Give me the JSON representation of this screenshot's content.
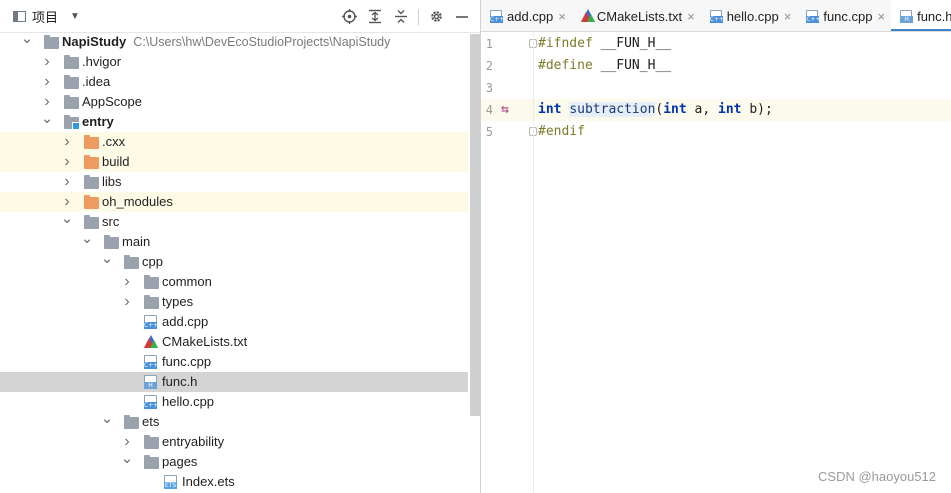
{
  "project_panel": {
    "title": "项目",
    "tools": [
      "crosshair-icon",
      "expand-all-icon",
      "collapse-all-icon",
      "gear-icon",
      "hide-icon"
    ]
  },
  "tree": [
    {
      "name": "NapiStudy",
      "path": "C:\\Users\\hw\\DevEcoStudioProjects\\NapiStudy",
      "depth": 0,
      "type": "folder",
      "expanded": true,
      "bold": true
    },
    {
      "name": ".hvigor",
      "depth": 1,
      "type": "folder",
      "expanded": false
    },
    {
      "name": ".idea",
      "depth": 1,
      "type": "folder",
      "expanded": false
    },
    {
      "name": "AppScope",
      "depth": 1,
      "type": "folder",
      "expanded": false
    },
    {
      "name": "entry",
      "depth": 1,
      "type": "module",
      "expanded": true,
      "bold": true
    },
    {
      "name": ".cxx",
      "depth": 2,
      "type": "folder-orange",
      "expanded": false,
      "excluded": true
    },
    {
      "name": "build",
      "depth": 2,
      "type": "folder-orange",
      "expanded": false,
      "excluded": true
    },
    {
      "name": "libs",
      "depth": 2,
      "type": "folder",
      "expanded": false
    },
    {
      "name": "oh_modules",
      "depth": 2,
      "type": "folder-orange",
      "expanded": false,
      "excluded": true
    },
    {
      "name": "src",
      "depth": 2,
      "type": "folder",
      "expanded": true
    },
    {
      "name": "main",
      "depth": 3,
      "type": "folder",
      "expanded": true
    },
    {
      "name": "cpp",
      "depth": 4,
      "type": "folder",
      "expanded": true
    },
    {
      "name": "common",
      "depth": 5,
      "type": "folder",
      "expanded": false
    },
    {
      "name": "types",
      "depth": 5,
      "type": "folder",
      "expanded": false
    },
    {
      "name": "add.cpp",
      "depth": 5,
      "type": "cpp"
    },
    {
      "name": "CMakeLists.txt",
      "depth": 5,
      "type": "cmake"
    },
    {
      "name": "func.cpp",
      "depth": 5,
      "type": "cpp"
    },
    {
      "name": "func.h",
      "depth": 5,
      "type": "h",
      "selected": true
    },
    {
      "name": "hello.cpp",
      "depth": 5,
      "type": "cpp"
    },
    {
      "name": "ets",
      "depth": 4,
      "type": "folder",
      "expanded": true
    },
    {
      "name": "entryability",
      "depth": 5,
      "type": "folder",
      "expanded": false
    },
    {
      "name": "pages",
      "depth": 5,
      "type": "folder",
      "expanded": true
    },
    {
      "name": "Index.ets",
      "depth": 6,
      "type": "ets"
    }
  ],
  "tabs": [
    {
      "label": "add.cpp",
      "type": "cpp",
      "closable": true
    },
    {
      "label": "CMakeLists.txt",
      "type": "cmake",
      "closable": true
    },
    {
      "label": "hello.cpp",
      "type": "cpp",
      "closable": true
    },
    {
      "label": "func.cpp",
      "type": "cpp",
      "closable": true
    },
    {
      "label": "func.h",
      "type": "h",
      "closable": true,
      "active": true
    }
  ],
  "file_type_tags": {
    "cpp": "C++",
    "h": "H",
    "ets": "ETS"
  },
  "editor": {
    "lines": [
      {
        "num": "1",
        "tokens": [
          {
            "t": "#ifndef ",
            "c": "pp"
          },
          {
            "t": "__FUN_H__"
          }
        ]
      },
      {
        "num": "2",
        "tokens": [
          {
            "t": "#define ",
            "c": "pp"
          },
          {
            "t": "__FUN_H__"
          }
        ]
      },
      {
        "num": "3",
        "tokens": []
      },
      {
        "num": "4",
        "current": true,
        "tokens": [
          {
            "t": "int",
            "c": "kw"
          },
          {
            "t": " "
          },
          {
            "t": "subtraction",
            "c": "fn-hl"
          },
          {
            "t": "("
          },
          {
            "t": "int",
            "c": "kw"
          },
          {
            "t": " a, "
          },
          {
            "t": "int",
            "c": "kw"
          },
          {
            "t": " b);"
          }
        ]
      },
      {
        "num": "5",
        "tokens": [
          {
            "t": "#endif",
            "c": "pp"
          }
        ]
      }
    ]
  },
  "watermark": "CSDN @haoyou512",
  "colors": {
    "accent": "#4083c9",
    "keyword": "#0033b3",
    "preprocessor": "#7c7c2b",
    "excluded_bg": "#fdfbe6",
    "selected_bg": "#d4d4d4"
  }
}
